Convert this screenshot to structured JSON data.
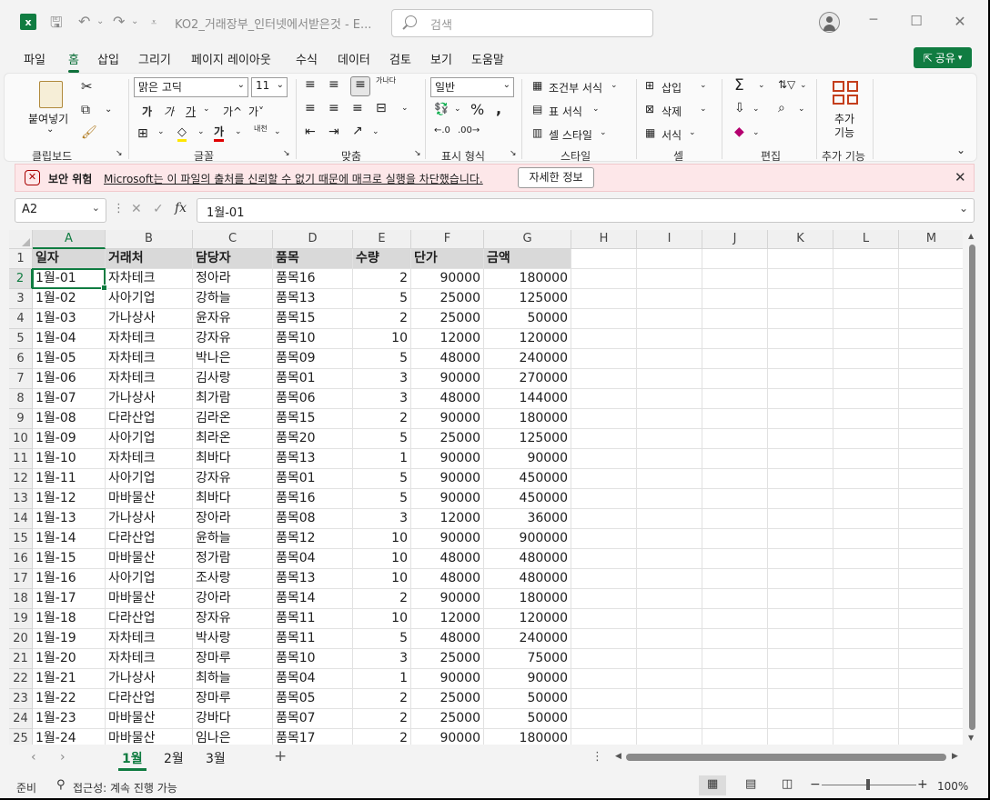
{
  "titlebar": {
    "filename": "KO2_거래장부_인터넷에서받은것 - E...",
    "search_placeholder": "검색"
  },
  "menu": {
    "tabs": [
      "파일",
      "홈",
      "삽입",
      "그리기",
      "페이지 레이아웃",
      "수식",
      "데이터",
      "검토",
      "보기",
      "도움말"
    ],
    "active": "홈",
    "share_label": "공유"
  },
  "ribbon": {
    "clipboard": {
      "paste_label": "붙여넣기",
      "group_label": "클립보드"
    },
    "font": {
      "font_name": "맑은 고딕",
      "font_size": "11",
      "bold": "가",
      "italic": "가",
      "underline": "가",
      "grow": "가^",
      "shrink": "가˅",
      "phonetic": "내천",
      "group_label": "글꼴"
    },
    "alignment": {
      "group_label": "맞춤",
      "wrap_label": "가나다"
    },
    "number": {
      "format": "일반",
      "group_label": "표시 형식"
    },
    "styles": {
      "conditional": "조건부 서식",
      "table": "표 서식",
      "cell": "셀 스타일",
      "group_label": "스타일"
    },
    "cells": {
      "insert": "삽입",
      "delete": "삭제",
      "format": "서식",
      "group_label": "셀"
    },
    "editing": {
      "group_label": "편집"
    },
    "addins": {
      "label_line1": "추가",
      "label_line2": "기능",
      "group_label": "추가 기능"
    }
  },
  "warning": {
    "title": "보안 위험",
    "message": "Microsoft는 이 파일의 출처를 신뢰할 수 없기 때문에 매크로 실행을 차단했습니다.",
    "button": "자세한 정보"
  },
  "formula_bar": {
    "name_box": "A2",
    "fx": "fx",
    "content": "1월-01"
  },
  "sheet": {
    "columns": [
      "A",
      "B",
      "C",
      "D",
      "E",
      "F",
      "G",
      "H",
      "I",
      "J",
      "K",
      "L",
      "M"
    ],
    "header": [
      "일자",
      "거래처",
      "담당자",
      "품목",
      "수량",
      "단가",
      "금액"
    ],
    "rows": [
      [
        "1월-01",
        "자차테크",
        "정아라",
        "품목16",
        "2",
        "90000",
        "180000"
      ],
      [
        "1월-02",
        "사아기업",
        "강하늘",
        "품목13",
        "5",
        "25000",
        "125000"
      ],
      [
        "1월-03",
        "가나상사",
        "윤자유",
        "품목15",
        "2",
        "25000",
        "50000"
      ],
      [
        "1월-04",
        "자차테크",
        "강자유",
        "품목10",
        "10",
        "12000",
        "120000"
      ],
      [
        "1월-05",
        "자차테크",
        "박나은",
        "품목09",
        "5",
        "48000",
        "240000"
      ],
      [
        "1월-06",
        "자차테크",
        "김사랑",
        "품목01",
        "3",
        "90000",
        "270000"
      ],
      [
        "1월-07",
        "가나상사",
        "최가람",
        "품목06",
        "3",
        "48000",
        "144000"
      ],
      [
        "1월-08",
        "다라산업",
        "김라온",
        "품목15",
        "2",
        "90000",
        "180000"
      ],
      [
        "1월-09",
        "사아기업",
        "최라온",
        "품목20",
        "5",
        "25000",
        "125000"
      ],
      [
        "1월-10",
        "자차테크",
        "최바다",
        "품목13",
        "1",
        "90000",
        "90000"
      ],
      [
        "1월-11",
        "사아기업",
        "강자유",
        "품목01",
        "5",
        "90000",
        "450000"
      ],
      [
        "1월-12",
        "마바물산",
        "최바다",
        "품목16",
        "5",
        "90000",
        "450000"
      ],
      [
        "1월-13",
        "가나상사",
        "장아라",
        "품목08",
        "3",
        "12000",
        "36000"
      ],
      [
        "1월-14",
        "다라산업",
        "윤하늘",
        "품목12",
        "10",
        "90000",
        "900000"
      ],
      [
        "1월-15",
        "마바물산",
        "정가람",
        "품목04",
        "10",
        "48000",
        "480000"
      ],
      [
        "1월-16",
        "사아기업",
        "조사랑",
        "품목13",
        "10",
        "48000",
        "480000"
      ],
      [
        "1월-17",
        "마바물산",
        "강아라",
        "품목14",
        "2",
        "90000",
        "180000"
      ],
      [
        "1월-18",
        "다라산업",
        "장자유",
        "품목11",
        "10",
        "12000",
        "120000"
      ],
      [
        "1월-19",
        "자차테크",
        "박사랑",
        "품목11",
        "5",
        "48000",
        "240000"
      ],
      [
        "1월-20",
        "자차테크",
        "장마루",
        "품목10",
        "3",
        "25000",
        "75000"
      ],
      [
        "1월-21",
        "가나상사",
        "최하늘",
        "품목04",
        "1",
        "90000",
        "90000"
      ],
      [
        "1월-22",
        "다라산업",
        "장마루",
        "품목05",
        "2",
        "25000",
        "50000"
      ],
      [
        "1월-23",
        "마바물산",
        "강바다",
        "품목07",
        "2",
        "25000",
        "50000"
      ],
      [
        "1월-24",
        "마바물산",
        "임나은",
        "품목17",
        "2",
        "90000",
        "180000"
      ]
    ],
    "tabs": [
      "1월",
      "2월",
      "3월"
    ],
    "active_tab": "1월"
  },
  "status": {
    "ready": "준비",
    "accessibility": "접근성: 계속 진행 가능",
    "zoom": "100%"
  },
  "colors": {
    "accent": "#107c41",
    "warning_bg": "#fde7e9"
  }
}
